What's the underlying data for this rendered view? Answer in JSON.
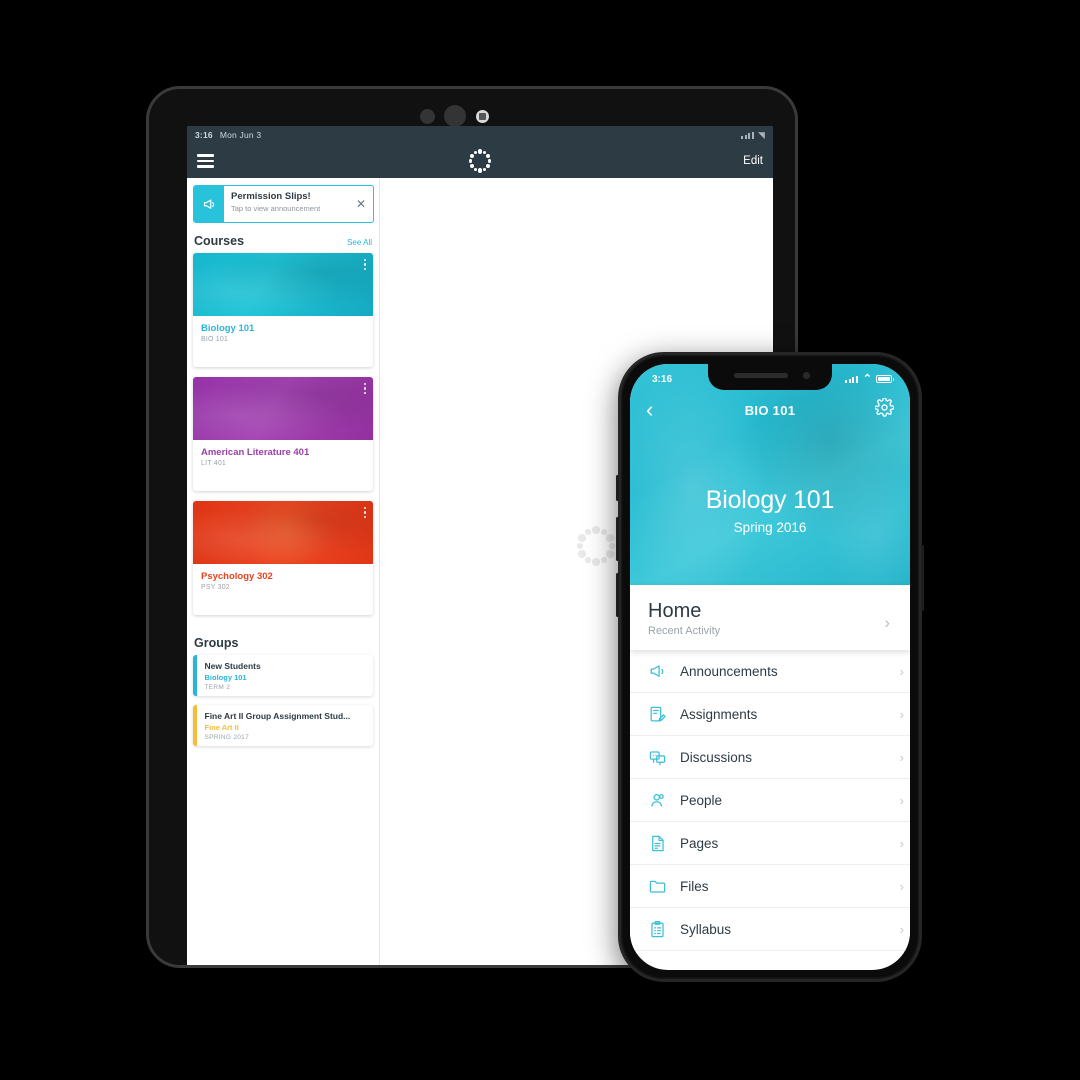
{
  "colors": {
    "cyan": "#29b5d8",
    "hero_cyan": "#2bbed3",
    "purple": "#9a3fa8",
    "orange": "#e8441f",
    "amber": "#f5bd39",
    "dark_nav": "#2d3b45",
    "text": "#2d3b45",
    "muted": "#9aa3a9"
  },
  "tablet": {
    "status": {
      "time": "3:16",
      "date": "Mon Jun 3",
      "signal_icon": "cellular-signal-icon"
    },
    "nav": {
      "menu_icon": "hamburger-menu-icon",
      "logo_icon": "canvas-logo-icon",
      "edit_label": "Edit"
    },
    "announcement": {
      "icon": "megaphone-icon",
      "title": "Permission Slips!",
      "subtitle": "Tap to view announcement",
      "close_icon": "close-icon"
    },
    "courses_section": {
      "title": "Courses",
      "see_all_label": "See All"
    },
    "courses": [
      {
        "name": "Biology 101",
        "code": "BIO 101",
        "color": "cyan",
        "menu_icon": "kebab-menu-icon"
      },
      {
        "name": "American Literature 401",
        "code": "LIT 401",
        "color": "purple",
        "menu_icon": "kebab-menu-icon"
      },
      {
        "name": "Psychology 302",
        "code": "PSY 302",
        "color": "orange",
        "menu_icon": "kebab-menu-icon"
      }
    ],
    "groups_section": {
      "title": "Groups"
    },
    "groups": [
      {
        "name": "New Students",
        "course": "Biology 101",
        "term": "TERM 2",
        "color": "cyan"
      },
      {
        "name": "Fine Art II Group Assignment Stud...",
        "course": "Fine Art II",
        "term": "SPRING 2017",
        "color": "amber"
      }
    ]
  },
  "loading": {
    "icon": "canvas-loading-spinner"
  },
  "phone": {
    "status": {
      "time": "3:16",
      "signal_icon": "cellular-signal-icon",
      "wifi_icon": "wifi-icon",
      "battery_icon": "battery-icon"
    },
    "topbar": {
      "back_icon": "back-chevron-icon",
      "title": "BIO 101",
      "settings_icon": "gear-icon"
    },
    "hero": {
      "course": "Biology 101",
      "term": "Spring 2016"
    },
    "home_card": {
      "title": "Home",
      "subtitle": "Recent Activity",
      "chevron_icon": "chevron-right-icon"
    },
    "menu": [
      {
        "label": "Announcements",
        "icon": "megaphone-icon"
      },
      {
        "label": "Assignments",
        "icon": "assignment-edit-icon"
      },
      {
        "label": "Discussions",
        "icon": "discussion-bubbles-icon"
      },
      {
        "label": "People",
        "icon": "people-icon"
      },
      {
        "label": "Pages",
        "icon": "page-document-icon"
      },
      {
        "label": "Files",
        "icon": "folder-icon"
      },
      {
        "label": "Syllabus",
        "icon": "clipboard-icon"
      }
    ]
  }
}
